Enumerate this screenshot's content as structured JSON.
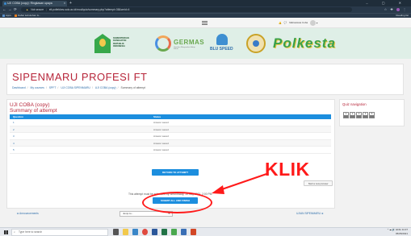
{
  "browser": {
    "tab_title": "UJI COBA (copy): Ringkasan upaya",
    "tab_close": "×",
    "new_tab": "+",
    "window_controls": "–  ▢  ✕",
    "security_label": "Not secure",
    "url": "elt.poltekkes-solo.ac.id/mod/quiz/summary.php?attempt=38&cmid=4",
    "bookmarks": [
      {
        "label": "Apps"
      },
      {
        "label": "Daftar kebutuhan &..."
      }
    ],
    "reading_list": "Reading list"
  },
  "moodle_nav": {
    "user_name": "Mahasiswa Coba"
  },
  "banner": {
    "kemdik_lines": [
      "KEMENTERIAN",
      "KESEHATAN",
      "REPUBLIK",
      "INDONESIA"
    ],
    "germas_text": "GERMAS",
    "germas_sub": "Gerakan Masyarakat Hidup Sehat",
    "blu_text": "BLU SPEED",
    "polkes_text": "Polkesta"
  },
  "header": {
    "course_title": "SIPENMARU PROFESI FT",
    "breadcrumb": [
      "Dashboard",
      "My courses",
      "SPFT",
      "UJI COBA SIPENMARU",
      "UJI COBA (copy)",
      "Summary of attempt"
    ]
  },
  "main": {
    "quiz_title": "UJI COBA (copy)",
    "summary_title": "Summary of attempt",
    "table": {
      "headers": [
        "Question",
        "Status"
      ],
      "rows": [
        {
          "q": "1",
          "status": "Answer saved"
        },
        {
          "q": "2",
          "status": "Answer saved"
        },
        {
          "q": "3",
          "status": "Answer saved"
        },
        {
          "q": "4",
          "status": "Answer saved"
        },
        {
          "q": "5",
          "status": "Answer saved"
        }
      ]
    },
    "return_button": "RETURN TO ATTEMPT",
    "note": "This attempt must be submitted by Wednesday, 19 May 2021, 2:00 PM.",
    "submit_button": "SUBMIT ALL AND FINISH",
    "small_button": "Start a new preview"
  },
  "footer_nav": {
    "prev": "◄ Announcements",
    "jump": "Jump to...",
    "next": "UJIAN SIPENMARU ►"
  },
  "quiz_navigation": {
    "title": "Quiz navigation",
    "questions": [
      "1",
      "2",
      "3",
      "4",
      "5"
    ]
  },
  "annotation": {
    "text": "KLIK",
    "color": "#ff1a1a"
  },
  "taskbar": {
    "search_placeholder": "Type here to search",
    "time": "11:07",
    "date": "05/05/2021",
    "tray_icons": "^  ☁  🔊  ENG"
  },
  "colors": {
    "brand_red": "#b7263a",
    "primary_blue": "#1c8ede",
    "link_blue": "#2f6fab"
  }
}
